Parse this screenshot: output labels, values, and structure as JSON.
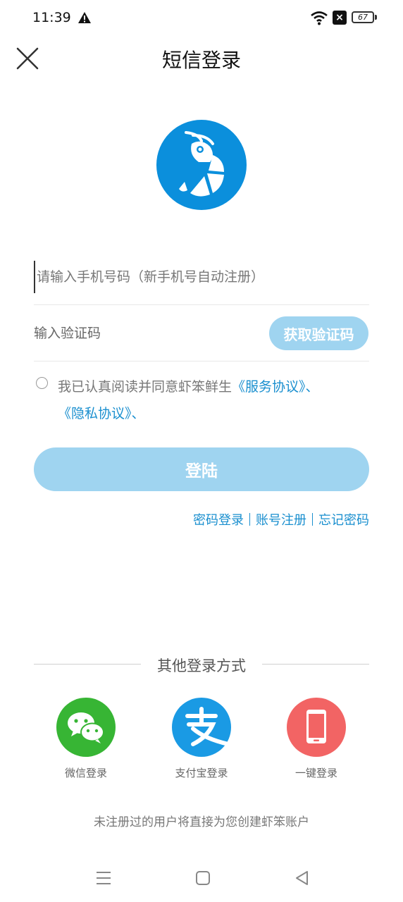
{
  "status_bar": {
    "time": "11:39",
    "battery": "67"
  },
  "header": {
    "title": "短信登录"
  },
  "form": {
    "phone_placeholder": "请输入手机号码（新手机号自动注册）",
    "code_placeholder": "输入验证码",
    "get_code_label": "获取验证码"
  },
  "agreement": {
    "prefix": "我已认真阅读并同意虾笨鲜生",
    "service_link": "《服务协议》",
    "sep1": "、",
    "privacy_link": "《隐私协议》",
    "sep2": "、"
  },
  "login_label": "登陆",
  "links": {
    "password_login": "密码登录",
    "register": "账号注册",
    "forgot": "忘记密码"
  },
  "other": {
    "title": "其他登录方式",
    "wechat": "微信登录",
    "alipay": "支付宝登录",
    "onekey": "一键登录"
  },
  "footer_note": "未注册过的用户将直接为您创建虾笨账户",
  "colors": {
    "brand": "#0b8fdc",
    "button_disabled": "#9fd4f0",
    "link": "#1a8fcf"
  }
}
